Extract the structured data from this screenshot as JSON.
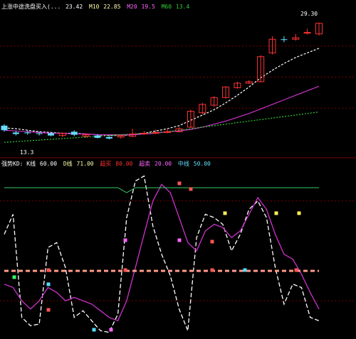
{
  "colors": {
    "background": "#000000",
    "grid": "#7a0000",
    "candle_up": "#ff3333",
    "candle_down": "#66ddff",
    "ma5": "#ffffff",
    "ma10": "#ffffaa",
    "ma20": "#cc33cc",
    "ma60": "#33cc33",
    "k_line": "#ffffff",
    "d_line": "#cc33cc",
    "upper_line": "#33cc66",
    "base_line": "#ff9988",
    "marker_red": "#ff5555",
    "marker_yellow": "#ffee55",
    "marker_cyan": "#55ddff",
    "marker_green": "#33ff66",
    "marker_magenta": "#ff66ff"
  },
  "top_panel": {
    "legend": [
      {
        "text": "上涨中途洗盘买入(...",
        "color": "#ffffff"
      },
      {
        "text": "23.42",
        "color": "#ffffff"
      },
      {
        "text": "M10",
        "color": "#ffffaa"
      },
      {
        "text": "22.85",
        "color": "#ffffaa"
      },
      {
        "text": "M20",
        "color": "#ff66ff"
      },
      {
        "text": "19.5",
        "color": "#ff66ff"
      },
      {
        "text": "M60",
        "color": "#33cc33"
      },
      {
        "text": "13.4",
        "color": "#33cc33"
      }
    ],
    "high_label": "29.30",
    "low_label": "13.3",
    "dashed_levels": [
      26.3,
      22.2,
      18.1
    ]
  },
  "bottom_panel": {
    "legend": [
      {
        "text": "强势KD: K线",
        "color": "#ffffff"
      },
      {
        "text": "60.00",
        "color": "#ffffff"
      },
      {
        "text": "D线",
        "color": "#ffffaa"
      },
      {
        "text": "71.00",
        "color": "#ffffaa"
      },
      {
        "text": "超买",
        "color": "#ff3333"
      },
      {
        "text": "80.00",
        "color": "#ff3333"
      },
      {
        "text": "超卖",
        "color": "#ff66ff"
      },
      {
        "text": "20.00",
        "color": "#ff66ff"
      },
      {
        "text": "中线",
        "color": "#66ddff"
      },
      {
        "text": "50.00",
        "color": "#66ddff"
      }
    ],
    "grid_levels": [
      80,
      20
    ]
  },
  "chart_data": [
    {
      "type": "candlestick",
      "title": "",
      "ylim": [
        12.5,
        30.5
      ],
      "candles": [
        {
          "o": 15.8,
          "c": 15.2,
          "h": 16.0,
          "l": 15.0
        },
        {
          "o": 14.9,
          "c": 14.7,
          "h": 15.1,
          "l": 14.5
        },
        {
          "o": 14.9,
          "c": 14.8,
          "h": 15.2,
          "l": 14.6
        },
        {
          "o": 14.8,
          "c": 14.7,
          "h": 15.0,
          "l": 14.5
        },
        {
          "o": 14.8,
          "c": 14.5,
          "h": 15.0,
          "l": 14.4
        },
        {
          "o": 14.5,
          "c": 14.8,
          "h": 14.9,
          "l": 14.3
        },
        {
          "o": 15.0,
          "c": 14.6,
          "h": 15.2,
          "l": 14.4
        },
        {
          "o": 14.4,
          "c": 14.6,
          "h": 14.8,
          "l": 14.2
        },
        {
          "o": 14.5,
          "c": 14.2,
          "h": 14.7,
          "l": 14.1
        },
        {
          "o": 14.3,
          "c": 14.1,
          "h": 14.4,
          "l": 14.0
        },
        {
          "o": 14.3,
          "c": 14.5,
          "h": 14.6,
          "l": 14.1
        },
        {
          "o": 14.4,
          "c": 14.7,
          "h": 15.4,
          "l": 14.3
        },
        {
          "o": 14.7,
          "c": 14.8,
          "h": 15.1,
          "l": 14.6
        },
        {
          "o": 14.8,
          "c": 14.9,
          "h": 15.3,
          "l": 14.7
        },
        {
          "o": 14.9,
          "c": 15.0,
          "h": 15.4,
          "l": 14.8
        },
        {
          "o": 15.0,
          "c": 15.4,
          "h": 15.6,
          "l": 14.9
        },
        {
          "o": 15.6,
          "c": 17.7,
          "h": 17.9,
          "l": 15.5
        },
        {
          "o": 17.5,
          "c": 18.6,
          "h": 18.8,
          "l": 17.3
        },
        {
          "o": 18.5,
          "c": 19.5,
          "h": 19.7,
          "l": 18.3
        },
        {
          "o": 19.5,
          "c": 20.9,
          "h": 21.0,
          "l": 19.4
        },
        {
          "o": 20.8,
          "c": 21.4,
          "h": 21.6,
          "l": 20.7
        },
        {
          "o": 21.4,
          "c": 21.6,
          "h": 21.8,
          "l": 21.3
        },
        {
          "o": 21.6,
          "c": 24.9,
          "h": 25.1,
          "l": 21.5
        },
        {
          "o": 25.4,
          "c": 27.2,
          "h": 27.6,
          "l": 25.2
        },
        {
          "o": 27.2,
          "c": 27.1,
          "h": 27.6,
          "l": 26.8
        },
        {
          "o": 27.2,
          "c": 27.4,
          "h": 27.9,
          "l": 27.0
        },
        {
          "o": 28.0,
          "c": 28.1,
          "h": 28.6,
          "l": 27.8
        },
        {
          "o": 27.9,
          "c": 29.3,
          "h": 29.4,
          "l": 27.7
        }
      ],
      "series": [
        {
          "name": "M10",
          "values": [
            15.5,
            15.4,
            15.2,
            15.0,
            14.9,
            14.8,
            14.8,
            14.7,
            14.6,
            14.5,
            14.5,
            14.6,
            14.8,
            15.1,
            15.4,
            15.8,
            16.5,
            17.2,
            17.9,
            18.8,
            19.8,
            20.9,
            22.1,
            23.1,
            24.0,
            24.8,
            25.4,
            26.0
          ]
        },
        {
          "name": "M20",
          "values": [
            15.2,
            15.1,
            15.0,
            14.9,
            14.8,
            14.8,
            14.7,
            14.7,
            14.6,
            14.6,
            14.6,
            14.6,
            14.7,
            14.8,
            15.0,
            15.1,
            15.3,
            15.6,
            16.0,
            16.4,
            16.9,
            17.4,
            18.0,
            18.6,
            19.2,
            19.8,
            20.4,
            21.0
          ]
        },
        {
          "name": "M60",
          "values": [
            13.6,
            13.7,
            13.8,
            13.9,
            14.0,
            14.1,
            14.2,
            14.3,
            14.4,
            14.5,
            14.6,
            14.7,
            14.8,
            14.9,
            15.0,
            15.2,
            15.4,
            15.6,
            15.8,
            16.0,
            16.2,
            16.4,
            16.6,
            16.8,
            17.0,
            17.2,
            17.4,
            17.6
          ]
        }
      ]
    },
    {
      "type": "line",
      "title": "",
      "ylim": [
        0,
        100
      ],
      "series": [
        {
          "name": "K线",
          "values": [
            60,
            72,
            10,
            5,
            6,
            52,
            55,
            40,
            10,
            14,
            8,
            2,
            1,
            12,
            70,
            92,
            95,
            65,
            48,
            35,
            15,
            2,
            58,
            72,
            70,
            66,
            50,
            60,
            75,
            80,
            70,
            40,
            18,
            30,
            28,
            10,
            8
          ]
        },
        {
          "name": "D线",
          "values": [
            30,
            28,
            20,
            15,
            20,
            28,
            25,
            20,
            22,
            20,
            18,
            14,
            10,
            8,
            20,
            40,
            60,
            80,
            90,
            85,
            70,
            55,
            50,
            62,
            66,
            64,
            58,
            62,
            72,
            82,
            75,
            60,
            48,
            45,
            36,
            25,
            15
          ]
        },
        {
          "name": "超买",
          "values": [
            88,
            88,
            88,
            88,
            88,
            88,
            88,
            88,
            88,
            88,
            88,
            88,
            88,
            88,
            85,
            88,
            88,
            88,
            88,
            88,
            88,
            88,
            88,
            88,
            88,
            88,
            88,
            88,
            88,
            88,
            88,
            88,
            88,
            88,
            88,
            88,
            88
          ]
        },
        {
          "name": "中线",
          "values": [
            38,
            38,
            38,
            38,
            38,
            38,
            38,
            38,
            38,
            38,
            38,
            38,
            38,
            38,
            38,
            38,
            38,
            38,
            38,
            38,
            38,
            38,
            38,
            38,
            38,
            38,
            38,
            38,
            38,
            38,
            38,
            38,
            38,
            38,
            38,
            38,
            38
          ]
        }
      ]
    }
  ]
}
